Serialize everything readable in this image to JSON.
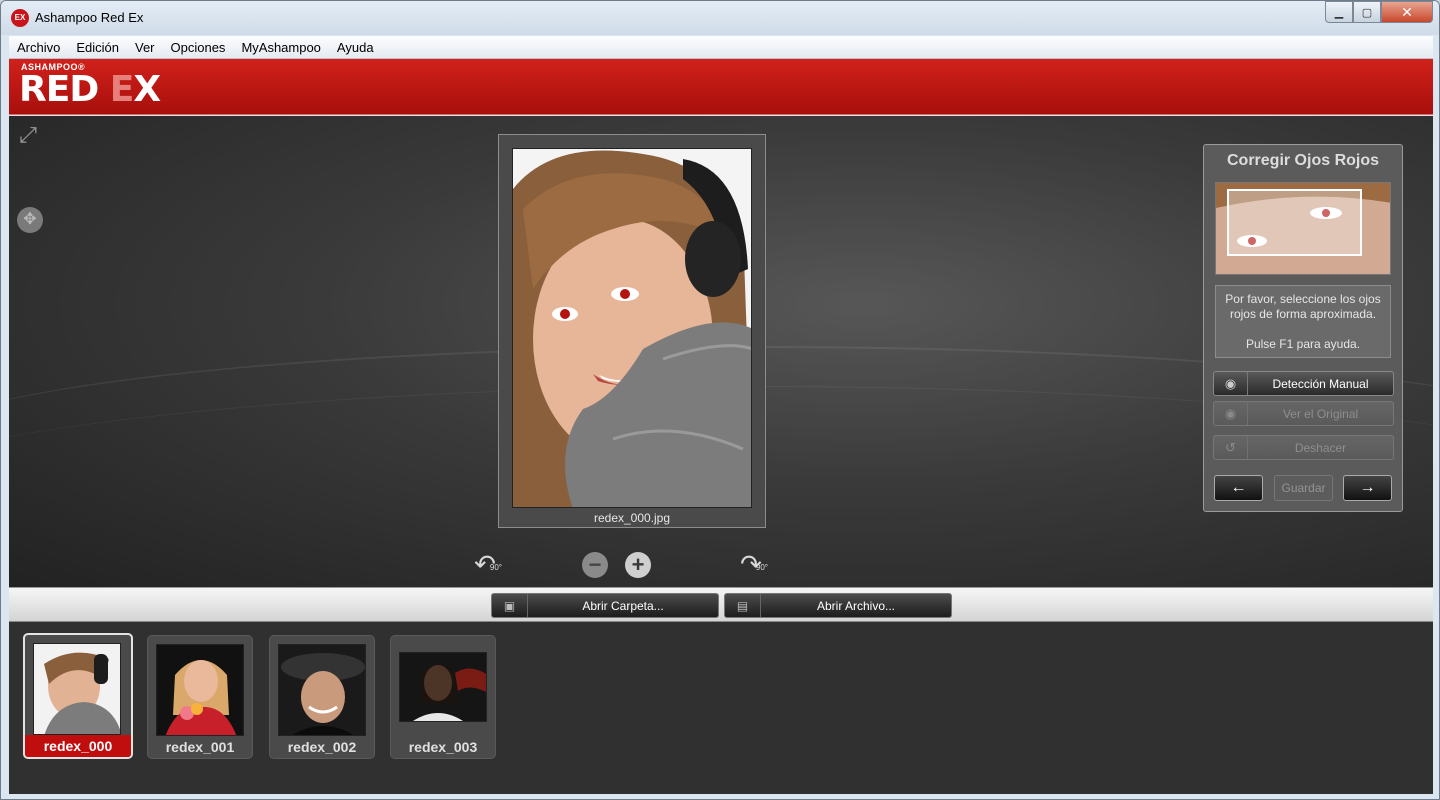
{
  "window": {
    "title": "Ashampoo Red Ex",
    "icon_text": "EX",
    "controls": {
      "minimize": "▁",
      "maximize": "▢",
      "close": "✕"
    }
  },
  "menu": [
    "Archivo",
    "Edición",
    "Ver",
    "Opciones",
    "MyAshampoo",
    "Ayuda"
  ],
  "brand": {
    "small": "ASHAMPOO®",
    "main": "RED ",
    "dim": "E",
    "x": "X"
  },
  "viewer": {
    "caption": "redex_000.jpg",
    "rotate_label": "90°",
    "zoom_out": "−",
    "zoom_in": "+"
  },
  "panel": {
    "title": "Corregir Ojos Rojos",
    "message": "Por favor, seleccione los ojos rojos de forma aproximada.",
    "help": "Pulse F1 para ayuda.",
    "btn_manual": "Detección Manual",
    "btn_original": "Ver el Original",
    "btn_undo": "Deshacer",
    "btn_save": "Guardar",
    "prev_arrow": "←",
    "next_arrow": "→"
  },
  "open": {
    "folder": "Abrir Carpeta...",
    "file": "Abrir Archivo..."
  },
  "thumbnails": [
    {
      "label": "redex_000"
    },
    {
      "label": "redex_001"
    },
    {
      "label": "redex_002"
    },
    {
      "label": "redex_003"
    }
  ],
  "colors": {
    "brand_red": "#c8141a",
    "active_thumb": "#c00d0d"
  }
}
